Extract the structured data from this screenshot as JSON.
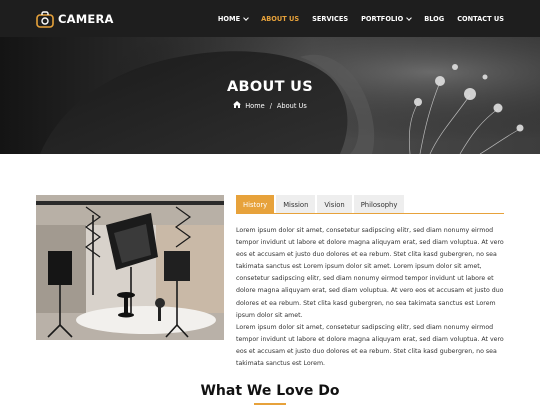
{
  "brand": {
    "name": "CAMERA"
  },
  "nav": {
    "items": [
      {
        "label": "HOME",
        "has_dropdown": true,
        "active": false
      },
      {
        "label": "ABOUT US",
        "has_dropdown": false,
        "active": true
      },
      {
        "label": "SERVICES",
        "has_dropdown": false,
        "active": false
      },
      {
        "label": "PORTFOLIO",
        "has_dropdown": true,
        "active": false
      },
      {
        "label": "BLOG",
        "has_dropdown": false,
        "active": false
      },
      {
        "label": "CONTACT US",
        "has_dropdown": false,
        "active": false
      }
    ]
  },
  "hero": {
    "title": "ABOUT US",
    "breadcrumb": {
      "home": "Home",
      "separator": "/",
      "current": "About Us"
    }
  },
  "about": {
    "tabs": [
      "History",
      "Mission",
      "Vision",
      "Philosophy"
    ],
    "active_tab": "History",
    "paragraphs": [
      "Lorem ipsum dolor sit amet, consetetur sadipscing elitr, sed diam nonumy eirmod tempor invidunt ut labore et dolore magna aliquyam erat, sed diam voluptua. At vero eos et accusam et justo duo dolores et ea rebum. Stet clita kasd gubergren, no sea takimata sanctus est Lorem ipsum dolor sit amet. Lorem ipsum dolor sit amet, consetetur sadipscing elitr, sed diam nonumy eirmod tempor invidunt ut labore et dolore magna aliquyam erat, sed diam voluptua. At vero eos et accusam et justo duo dolores et ea rebum. Stet clita kasd gubergren, no sea takimata sanctus est Lorem ipsum dolor sit amet.",
      "Lorem ipsum dolor sit amet, consetetur sadipscing elitr, sed diam nonumy eirmod tempor invidunt ut labore et dolore magna aliquyam erat, sed diam voluptua. At vero eos et accusam et justo duo dolores et ea rebum. Stet clita kasd gubergren, no sea takimata sanctus est Lorem."
    ]
  },
  "section": {
    "title": "What We Love Do"
  },
  "colors": {
    "accent": "#e7a23b",
    "header_bg": "#1e1e1e"
  },
  "icons": {
    "logo": "camera-bag-icon",
    "breadcrumb_home": "home-icon",
    "dropdown": "chevron-down-icon"
  }
}
